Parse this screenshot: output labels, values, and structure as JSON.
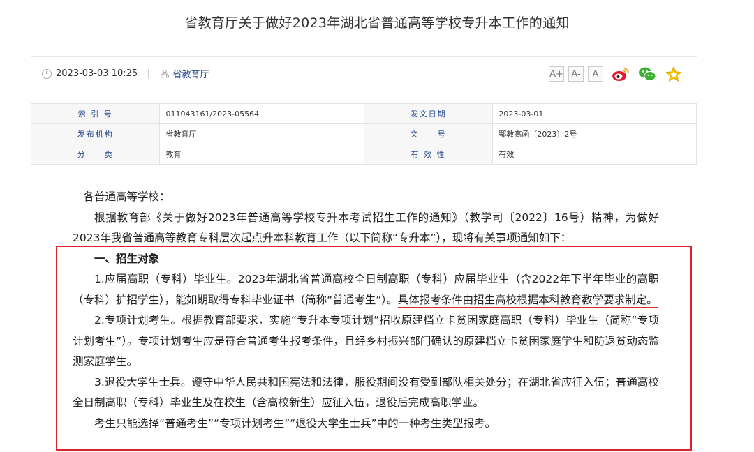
{
  "page": {
    "title": "省教育厅关于做好2023年湖北省普通高等学校专升本工作的通知"
  },
  "meta": {
    "datetime": "2023-03-03 10:25",
    "separator": "|",
    "source": "省教育厅",
    "font_large": "A+",
    "font_medium": "A-",
    "font_normal": "A"
  },
  "info_table": {
    "rows": [
      {
        "label1": "索 引 号",
        "value1": "011043161/2023-05564",
        "label2": "发文日期",
        "value2": "2023-03-01"
      },
      {
        "label1": "发布机构",
        "value1": "省教育厅",
        "label2": "文　　号",
        "value2": "鄂教高函〔2023〕2号"
      },
      {
        "label1": "分　　类",
        "value1": "教育",
        "label2": "有 效 性",
        "value2": "有效"
      }
    ]
  },
  "body": {
    "greeting": "各普通高等学校：",
    "intro": "根据教育部《关于做好2023年普通高等学校专升本考试招生工作的通知》（教学司〔2022〕16号）精神，为做好2023年我省普通高等教育专科层次起点升本科教育工作（以下简称“专升本”），现将有关事项通知如下：",
    "section1_title": "一、招生对象",
    "item1_a": "1.应届高职（专科）毕业生。2023年湖北省普通高校全日制高职（专科）应届毕业生（含2022年下半年毕业的高职（专科）扩招学生），能如期取得专科毕业证书（简称“普通考生”）。",
    "item1_b": "具体报考条件由招生高校根据本科教育教学要求制定。",
    "item2": "2.专项计划考生。根据教育部要求，实施“专升本专项计划”招收原建档立卡贫困家庭高职（专科）毕业生（简称“专项计划考生”）。专项计划考生应是符合普通考生报考条件，且经乡村振兴部门确认的原建档立卡贫困家庭学生和防返贫动态监测家庭学生。",
    "item3": "3.退役大学生士兵。遵守中华人民共和国宪法和法律，服役期间没有受到部队相关处分；在湖北省应征入伍；普通高校全日制高职（专科）毕业生及在校生（含高校新生）应征入伍，退役后完成高职学业。",
    "note": "考生只能选择“普通考生”“专项计划考生”“退役大学生士兵”中的一种考生类型报考。"
  },
  "colors": {
    "highlight": "#e0232b",
    "label_blue": "#2a4d8f"
  }
}
